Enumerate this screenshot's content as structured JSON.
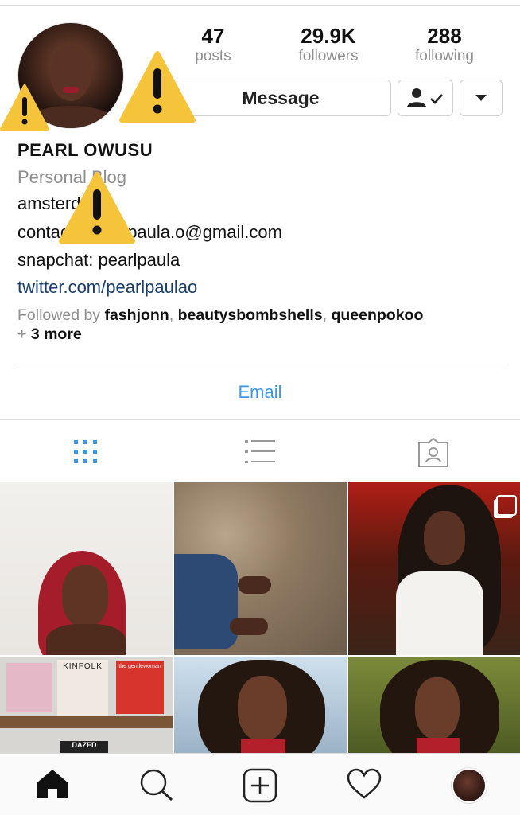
{
  "profile": {
    "stats": {
      "posts": {
        "value": "47",
        "label": "posts"
      },
      "followers": {
        "value": "29.9K",
        "label": "followers"
      },
      "following": {
        "value": "288",
        "label": "following"
      }
    },
    "message_label": "Message",
    "name": "PEARL OWUSU",
    "category": "Personal Blog",
    "bio_lines": [
      "amsterdam",
      "contact: pearl.paula.o@gmail.com",
      "snapchat: pearlpaula"
    ],
    "link": "twitter.com/pearlpaulao",
    "followed_by": {
      "prefix": "Followed by ",
      "names": [
        "fashjonn",
        "beautysbombshells",
        "queenpokoo"
      ],
      "more": "3 more",
      "plus": "+ "
    },
    "email_label": "Email"
  },
  "tabs": [
    {
      "name": "grid",
      "icon": "grid-icon",
      "active": true
    },
    {
      "name": "list",
      "icon": "list-icon",
      "active": false
    },
    {
      "name": "tagged",
      "icon": "tagged-icon",
      "active": false
    }
  ],
  "posts": [
    {
      "desc": "portrait red hair",
      "multi": false
    },
    {
      "desc": "gravel ground feet",
      "multi": false
    },
    {
      "desc": "curly hair white tee",
      "multi": true
    },
    {
      "desc": "magazines shelf",
      "labels": [
        "KINFOLK",
        "the gentlewoman",
        "DAZED"
      ],
      "multi": false
    },
    {
      "desc": "curly hair portrait",
      "multi": false
    },
    {
      "desc": "curly hair outdoor",
      "multi": false
    }
  ],
  "nav": [
    "home-icon",
    "search-icon",
    "add-post-icon",
    "heart-icon",
    "profile-avatar"
  ],
  "colors": {
    "accent": "#3897f0",
    "link": "#163d6b",
    "muted": "#8e8e8e",
    "warning": "#f5c43b"
  }
}
